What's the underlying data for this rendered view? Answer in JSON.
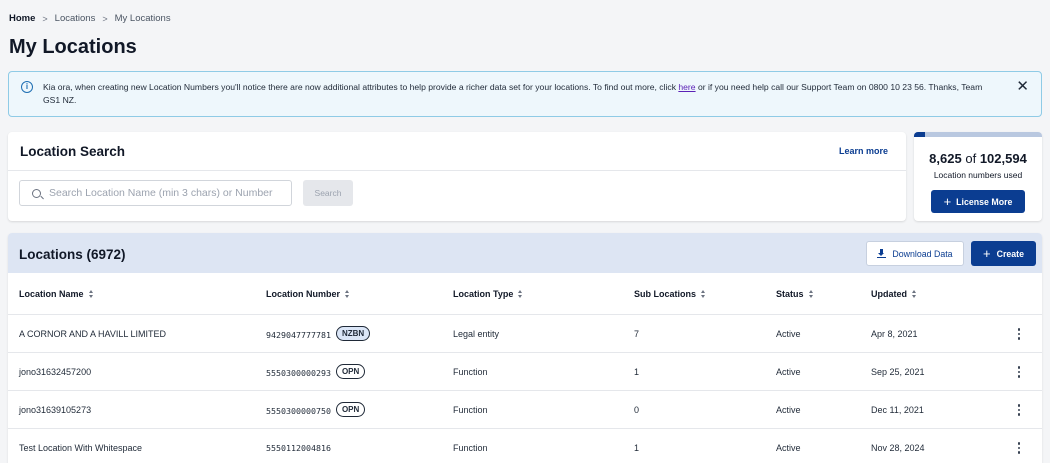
{
  "breadcrumb": {
    "home": "Home",
    "sep1": ">",
    "locations": "Locations",
    "sep2": ">",
    "current": "My Locations"
  },
  "page": {
    "title": "My Locations"
  },
  "alert": {
    "text_before": "Kia ora, when creating new Location Numbers you'll notice there are now additional attributes to help provide a richer data set for your locations. To find out more, click ",
    "link": "here",
    "text_after": " or if you need help call our Support Team on 0800 10 23 56. Thanks, Team GS1 NZ.",
    "close": "✕",
    "info": "i"
  },
  "search": {
    "title": "Location Search",
    "learn_more": "Learn more",
    "placeholder": "Search Location Name (min 3 chars) or Number",
    "button": "Search"
  },
  "usage": {
    "used": "8,625",
    "of": "of",
    "total": "102,594",
    "label": "Location numbers used",
    "fraction_used": 0.084,
    "button": "License More",
    "plus": "+"
  },
  "locations": {
    "title": "Locations (6972)",
    "download": "Download Data",
    "create": "Create",
    "plus": "+",
    "columns": [
      "Location Name",
      "Location Number",
      "Location Type",
      "Sub Locations",
      "Status",
      "Updated"
    ],
    "rows": [
      {
        "name": "A CORNOR AND A HAVILL LIMITED",
        "number": "9429047777781",
        "badge": "NZBN",
        "type": "Legal entity",
        "sub": "7",
        "status": "Active",
        "updated": "Apr 8, 2021"
      },
      {
        "name": "jono31632457200",
        "number": "5550300000293",
        "badge": "OPN",
        "type": "Function",
        "sub": "1",
        "status": "Active",
        "updated": "Sep 25, 2021"
      },
      {
        "name": "jono31639105273",
        "number": "5550300000750",
        "badge": "OPN",
        "type": "Function",
        "sub": "0",
        "status": "Active",
        "updated": "Dec 11, 2021"
      },
      {
        "name": "Test Location With Whitespace",
        "number": "5550112004816",
        "badge": "",
        "type": "Function",
        "sub": "1",
        "status": "Active",
        "updated": "Nov 28, 2024"
      }
    ]
  },
  "colors": {
    "primary": "#0b3d91",
    "header_bg": "#dde5f3",
    "alert_bg": "#eef7fc",
    "alert_border": "#8fcbe6"
  }
}
